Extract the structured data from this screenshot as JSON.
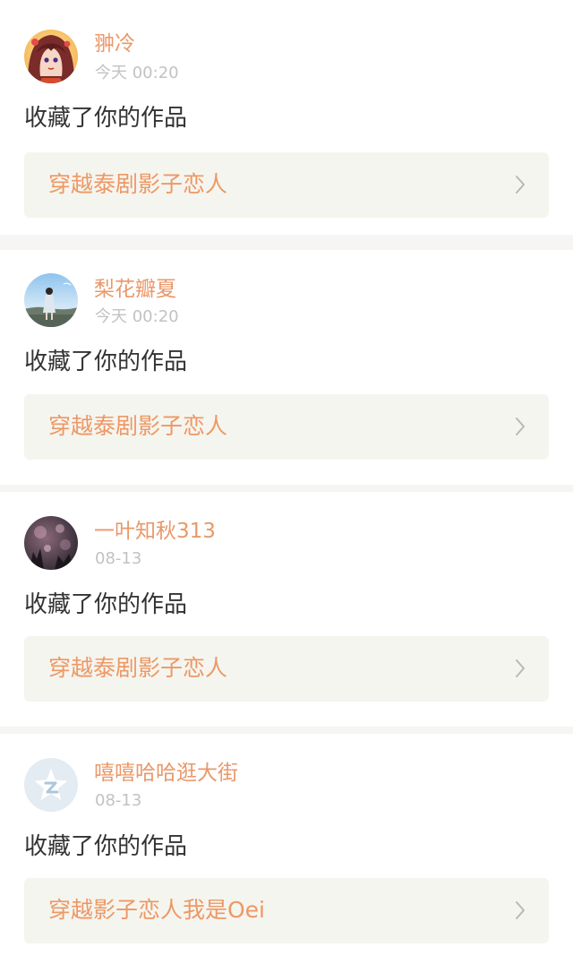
{
  "notifications": [
    {
      "username": "翀冷",
      "timestamp": "今天 00:20",
      "action": "收藏了你的作品",
      "work_title": "穿越泰剧影子恋人",
      "avatar": "anime-girl-avatar"
    },
    {
      "username": "梨花瓣夏",
      "timestamp": "今天 00:20",
      "action": "收藏了你的作品",
      "work_title": "穿越泰剧影子恋人",
      "avatar": "girl-in-field-avatar"
    },
    {
      "username": "一叶知秋313",
      "timestamp": "08-13",
      "action": "收藏了你的作品",
      "work_title": "穿越泰剧影子恋人",
      "avatar": "dark-bokeh-avatar"
    },
    {
      "username": "嘻嘻哈哈逛大街",
      "timestamp": "08-13",
      "action": "收藏了你的作品",
      "work_title": "穿越影子恋人我是Oei",
      "avatar": "default-star-avatar"
    }
  ],
  "colors": {
    "username": "#e9986a",
    "work_title": "#ed9865",
    "timestamp": "#c2c2c2",
    "action_text": "#333333",
    "link_background": "#f5f5ef",
    "page_background": "#f7f5f3"
  },
  "icons": {
    "link_arrow": "chevron-right-icon"
  }
}
